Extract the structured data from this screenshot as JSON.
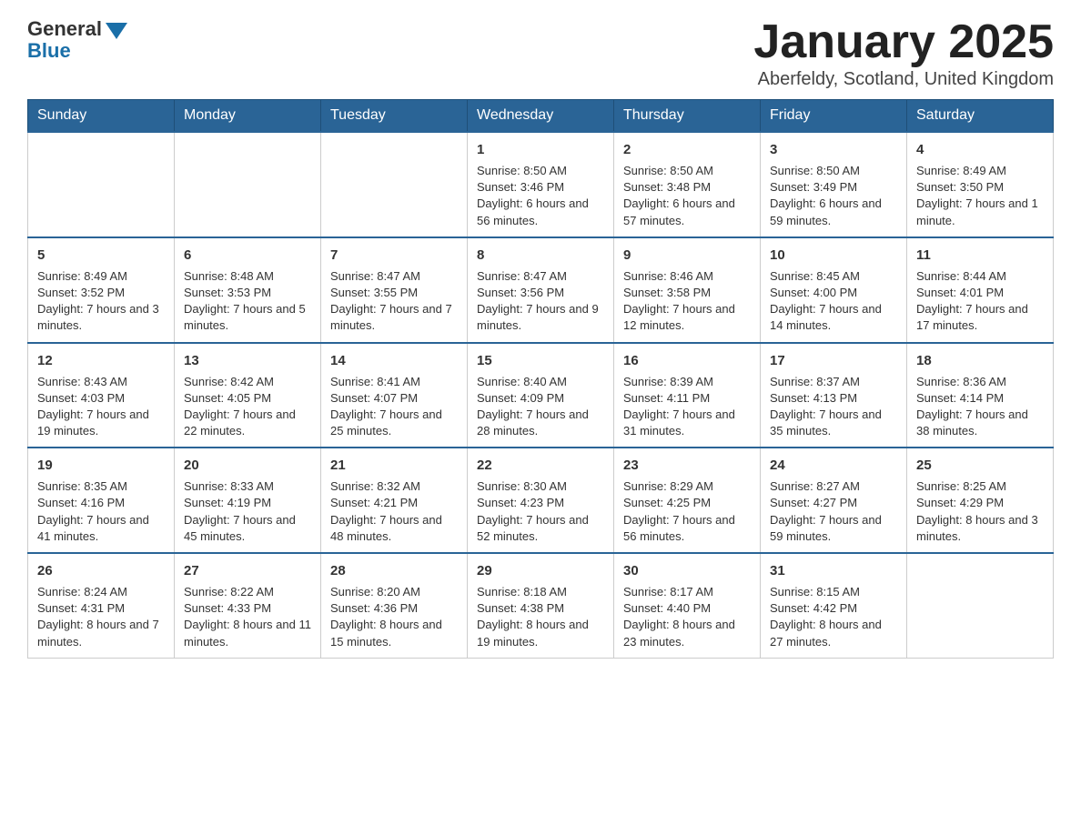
{
  "header": {
    "logo_line1": "General",
    "logo_line2": "Blue",
    "month_title": "January 2025",
    "location": "Aberfeldy, Scotland, United Kingdom"
  },
  "days_of_week": [
    "Sunday",
    "Monday",
    "Tuesday",
    "Wednesday",
    "Thursday",
    "Friday",
    "Saturday"
  ],
  "weeks": [
    [
      {
        "day": "",
        "info": ""
      },
      {
        "day": "",
        "info": ""
      },
      {
        "day": "",
        "info": ""
      },
      {
        "day": "1",
        "info": "Sunrise: 8:50 AM\nSunset: 3:46 PM\nDaylight: 6 hours and 56 minutes."
      },
      {
        "day": "2",
        "info": "Sunrise: 8:50 AM\nSunset: 3:48 PM\nDaylight: 6 hours and 57 minutes."
      },
      {
        "day": "3",
        "info": "Sunrise: 8:50 AM\nSunset: 3:49 PM\nDaylight: 6 hours and 59 minutes."
      },
      {
        "day": "4",
        "info": "Sunrise: 8:49 AM\nSunset: 3:50 PM\nDaylight: 7 hours and 1 minute."
      }
    ],
    [
      {
        "day": "5",
        "info": "Sunrise: 8:49 AM\nSunset: 3:52 PM\nDaylight: 7 hours and 3 minutes."
      },
      {
        "day": "6",
        "info": "Sunrise: 8:48 AM\nSunset: 3:53 PM\nDaylight: 7 hours and 5 minutes."
      },
      {
        "day": "7",
        "info": "Sunrise: 8:47 AM\nSunset: 3:55 PM\nDaylight: 7 hours and 7 minutes."
      },
      {
        "day": "8",
        "info": "Sunrise: 8:47 AM\nSunset: 3:56 PM\nDaylight: 7 hours and 9 minutes."
      },
      {
        "day": "9",
        "info": "Sunrise: 8:46 AM\nSunset: 3:58 PM\nDaylight: 7 hours and 12 minutes."
      },
      {
        "day": "10",
        "info": "Sunrise: 8:45 AM\nSunset: 4:00 PM\nDaylight: 7 hours and 14 minutes."
      },
      {
        "day": "11",
        "info": "Sunrise: 8:44 AM\nSunset: 4:01 PM\nDaylight: 7 hours and 17 minutes."
      }
    ],
    [
      {
        "day": "12",
        "info": "Sunrise: 8:43 AM\nSunset: 4:03 PM\nDaylight: 7 hours and 19 minutes."
      },
      {
        "day": "13",
        "info": "Sunrise: 8:42 AM\nSunset: 4:05 PM\nDaylight: 7 hours and 22 minutes."
      },
      {
        "day": "14",
        "info": "Sunrise: 8:41 AM\nSunset: 4:07 PM\nDaylight: 7 hours and 25 minutes."
      },
      {
        "day": "15",
        "info": "Sunrise: 8:40 AM\nSunset: 4:09 PM\nDaylight: 7 hours and 28 minutes."
      },
      {
        "day": "16",
        "info": "Sunrise: 8:39 AM\nSunset: 4:11 PM\nDaylight: 7 hours and 31 minutes."
      },
      {
        "day": "17",
        "info": "Sunrise: 8:37 AM\nSunset: 4:13 PM\nDaylight: 7 hours and 35 minutes."
      },
      {
        "day": "18",
        "info": "Sunrise: 8:36 AM\nSunset: 4:14 PM\nDaylight: 7 hours and 38 minutes."
      }
    ],
    [
      {
        "day": "19",
        "info": "Sunrise: 8:35 AM\nSunset: 4:16 PM\nDaylight: 7 hours and 41 minutes."
      },
      {
        "day": "20",
        "info": "Sunrise: 8:33 AM\nSunset: 4:19 PM\nDaylight: 7 hours and 45 minutes."
      },
      {
        "day": "21",
        "info": "Sunrise: 8:32 AM\nSunset: 4:21 PM\nDaylight: 7 hours and 48 minutes."
      },
      {
        "day": "22",
        "info": "Sunrise: 8:30 AM\nSunset: 4:23 PM\nDaylight: 7 hours and 52 minutes."
      },
      {
        "day": "23",
        "info": "Sunrise: 8:29 AM\nSunset: 4:25 PM\nDaylight: 7 hours and 56 minutes."
      },
      {
        "day": "24",
        "info": "Sunrise: 8:27 AM\nSunset: 4:27 PM\nDaylight: 7 hours and 59 minutes."
      },
      {
        "day": "25",
        "info": "Sunrise: 8:25 AM\nSunset: 4:29 PM\nDaylight: 8 hours and 3 minutes."
      }
    ],
    [
      {
        "day": "26",
        "info": "Sunrise: 8:24 AM\nSunset: 4:31 PM\nDaylight: 8 hours and 7 minutes."
      },
      {
        "day": "27",
        "info": "Sunrise: 8:22 AM\nSunset: 4:33 PM\nDaylight: 8 hours and 11 minutes."
      },
      {
        "day": "28",
        "info": "Sunrise: 8:20 AM\nSunset: 4:36 PM\nDaylight: 8 hours and 15 minutes."
      },
      {
        "day": "29",
        "info": "Sunrise: 8:18 AM\nSunset: 4:38 PM\nDaylight: 8 hours and 19 minutes."
      },
      {
        "day": "30",
        "info": "Sunrise: 8:17 AM\nSunset: 4:40 PM\nDaylight: 8 hours and 23 minutes."
      },
      {
        "day": "31",
        "info": "Sunrise: 8:15 AM\nSunset: 4:42 PM\nDaylight: 8 hours and 27 minutes."
      },
      {
        "day": "",
        "info": ""
      }
    ]
  ]
}
